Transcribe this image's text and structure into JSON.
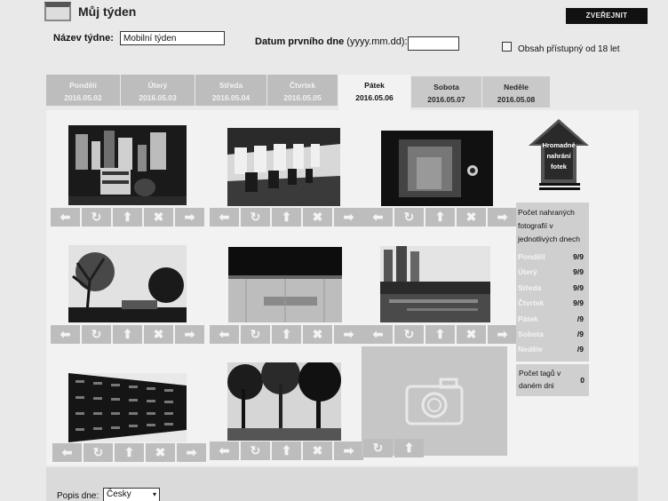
{
  "header": {
    "title": "Můj týden",
    "publish_label": "ZVEŘEJNIT"
  },
  "form": {
    "week_name_label": "Název týdne:",
    "week_name_value": "Mobilní týden",
    "first_day_label": "Datum prvního dne",
    "first_day_format": "(yyyy.mm.dd):",
    "first_day_value": "",
    "adult_label": "Obsah přístupný od 18 let"
  },
  "tabs": [
    {
      "name": "Pondělí",
      "date": "2016.05.02"
    },
    {
      "name": "Úterý",
      "date": "2016.05.03"
    },
    {
      "name": "Středa",
      "date": "2016.05.04"
    },
    {
      "name": "Čtvrtek",
      "date": "2016.05.05"
    },
    {
      "name": "Pátek",
      "date": "2016.05.06"
    },
    {
      "name": "Sobota",
      "date": "2016.05.07"
    },
    {
      "name": "Neděle",
      "date": "2016.05.08"
    }
  ],
  "active_tab": "Pátek",
  "toolbar_icons": [
    "arrow-left-icon",
    "rotate-icon",
    "cover-icon",
    "delete-icon",
    "arrow-right-icon"
  ],
  "upload": {
    "label_line1": "Hromadné",
    "label_line2": "nahrání",
    "label_line3": "fotek"
  },
  "stats": {
    "title_line1": "Počet nahraných",
    "title_line2": "fotografií v",
    "title_line3": "jednotlivých dnech",
    "rows": [
      {
        "day": "Pondělí",
        "value": "9/9"
      },
      {
        "day": "Úterý",
        "value": "9/9"
      },
      {
        "day": "Středa",
        "value": "9/9"
      },
      {
        "day": "Čtvrtek",
        "value": "9/9"
      },
      {
        "day": "Pátek",
        "value": "/9"
      },
      {
        "day": "Sobota",
        "value": "/9"
      },
      {
        "day": "Neděle",
        "value": "/9"
      }
    ]
  },
  "tags": {
    "label_line1": "Počet tagů v",
    "label_line2": "daném dni",
    "value": "0"
  },
  "bottom": {
    "description_label": "Popis dne:",
    "language_value": "Česky"
  }
}
